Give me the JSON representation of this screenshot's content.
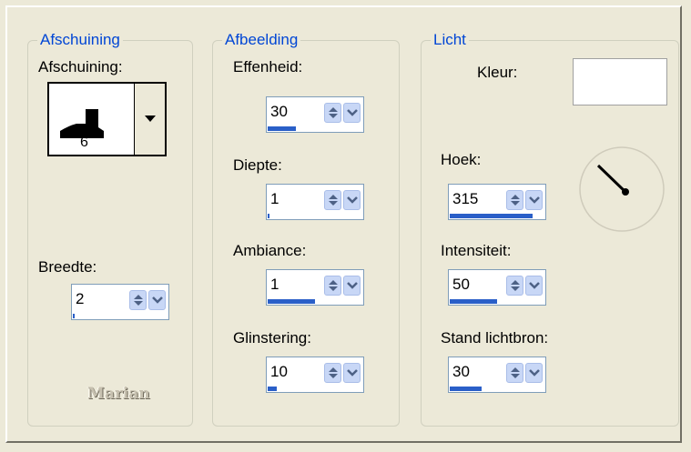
{
  "groups": {
    "bevel": {
      "title": "Afschuining",
      "bevel_label": "Afschuining:",
      "bevel_preview_number": "6",
      "width_label": "Breedte:",
      "width": {
        "value": "2",
        "level": 0.02
      }
    },
    "image": {
      "title": "Afbeelding",
      "smoothness_label": "Effenheid:",
      "smoothness": {
        "value": "30",
        "level": 0.3
      },
      "depth_label": "Diepte:",
      "depth": {
        "value": "1",
        "level": 0.01
      },
      "ambience_label": "Ambiance:",
      "ambience": {
        "value": "1",
        "level": 0.5
      },
      "shine_label": "Glinstering:",
      "shine": {
        "value": "10",
        "level": 0.1
      }
    },
    "light": {
      "title": "Licht",
      "color_label": "Kleur:",
      "color_value": "#ffffff",
      "angle_label": "Hoek:",
      "angle": {
        "value": "315",
        "level": 0.875
      },
      "intensity_label": "Intensiteit:",
      "intensity": {
        "value": "50",
        "level": 0.5
      },
      "elevation_label": "Stand lichtbron:",
      "elevation": {
        "value": "30",
        "level": 0.333
      }
    }
  },
  "watermark": "Marian",
  "colors": {
    "accent": "#0046d5",
    "fill": "#2a5fc8",
    "face": "#ece9d8"
  },
  "icons": {
    "spin_up_down": "up-down-arrows-icon",
    "dropdown": "chevron-down-icon"
  }
}
